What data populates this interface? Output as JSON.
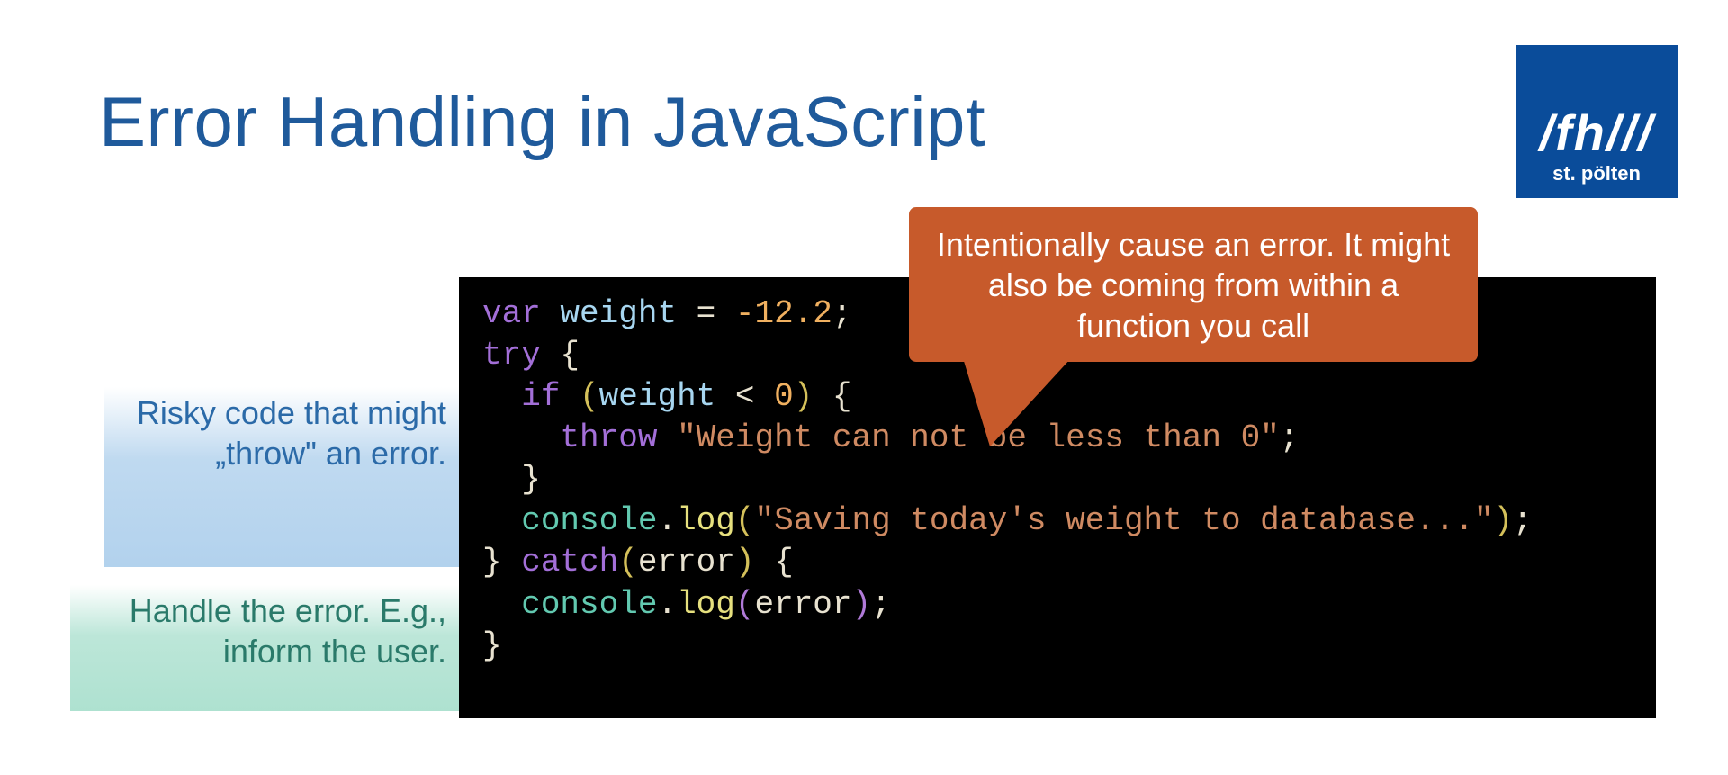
{
  "title": "Error Handling in JavaScript",
  "logo": {
    "main": "/fh///",
    "sub": "st. pölten"
  },
  "annotations": {
    "try_block": "Risky code that might „throw\" an error.",
    "catch_block": "Handle the error. E.g., inform the user."
  },
  "callout": "Intentionally cause an error. It might also be coming from within a function you call",
  "code": {
    "kw_var": "var",
    "ident_weight": "weight",
    "assign_eq": " = ",
    "num_weight": "-12.2",
    "semi": ";",
    "kw_try": "try",
    "brace_open": " {",
    "indent1": "  ",
    "kw_if": "if",
    "space": " ",
    "paren_open": "(",
    "lt": " < ",
    "num_zero": "0",
    "paren_close": ")",
    "indent2": "    ",
    "kw_throw": "throw",
    "str_throw": "\"Weight can not be less than 0\"",
    "brace_close_inner": "  }",
    "ident_console": "console",
    "dot": ".",
    "fn_log": "log",
    "str_saving": "\"Saving today's weight to database...\"",
    "brace_close": "}",
    "kw_catch": "catch",
    "ident_error": "error"
  }
}
